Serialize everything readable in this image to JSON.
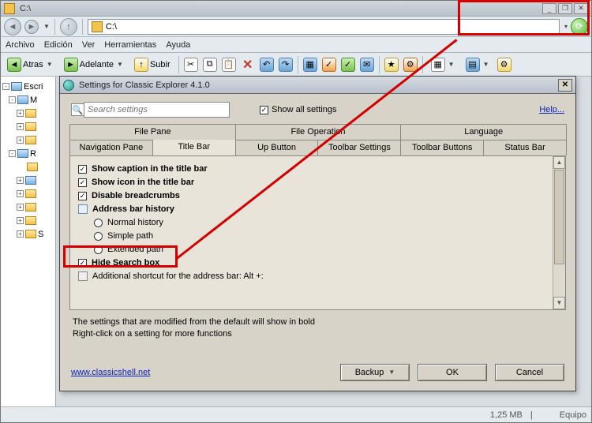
{
  "titlebar": {
    "path": "C:\\"
  },
  "nav": {
    "triangle": "▾"
  },
  "address": {
    "path": "C:\\"
  },
  "menus": [
    "Archivo",
    "Edición",
    "Ver",
    "Herramientas",
    "Ayuda"
  ],
  "cmds": {
    "back": "Atras",
    "forward": "Adelante",
    "up": "Subir"
  },
  "tree": {
    "root": "Escri",
    "rows": [
      {
        "depth": 0,
        "tgl": "-",
        "type": "blue",
        "txt": "M"
      },
      {
        "depth": 1,
        "tgl": "+",
        "type": "fld",
        "txt": ""
      },
      {
        "depth": 1,
        "tgl": "+",
        "type": "fld",
        "txt": ""
      },
      {
        "depth": 1,
        "tgl": "+",
        "type": "fld",
        "txt": ""
      },
      {
        "depth": 0,
        "tgl": "-",
        "type": "blue",
        "txt": "R"
      },
      {
        "depth": 1,
        "tgl": "",
        "type": "fld",
        "txt": ""
      },
      {
        "depth": 1,
        "tgl": "+",
        "type": "blue",
        "txt": ""
      },
      {
        "depth": 1,
        "tgl": "+",
        "type": "fld",
        "txt": ""
      },
      {
        "depth": 1,
        "tgl": "+",
        "type": "fld",
        "txt": ""
      },
      {
        "depth": 1,
        "tgl": "+",
        "type": "fld",
        "txt": ""
      },
      {
        "depth": 1,
        "tgl": "+",
        "type": "fld",
        "txt": "S"
      }
    ]
  },
  "status": {
    "size": "1,25 MB",
    "computer": "Equipo"
  },
  "dlg": {
    "title": "Settings for Classic Explorer 4.1.0",
    "search_placeholder": "Search settings",
    "show_all": "Show all settings",
    "help": "Help...",
    "tabs_top": [
      "File Pane",
      "File Operation",
      "Language"
    ],
    "tabs_bottom": [
      "Navigation Pane",
      "Title Bar",
      "Up Button",
      "Toolbar Settings",
      "Toolbar Buttons",
      "Status Bar"
    ],
    "active_tab": "Title Bar",
    "opts": {
      "caption": "Show caption in the title bar",
      "icon": "Show icon in the title bar",
      "breadcrumbs": "Disable breadcrumbs",
      "history_hdr": "Address bar history",
      "history_normal": "Normal history",
      "history_simple": "Simple path",
      "history_ext": "Extended path",
      "hide_search": "Hide Search box",
      "shortcut": "Additional shortcut for the address bar: Alt +:"
    },
    "hint1": "The settings that are modified from the default will show in bold",
    "hint2": "Right-click on a setting for more functions",
    "link": "www.classicshell.net",
    "btn_backup": "Backup",
    "btn_ok": "OK",
    "btn_cancel": "Cancel"
  }
}
